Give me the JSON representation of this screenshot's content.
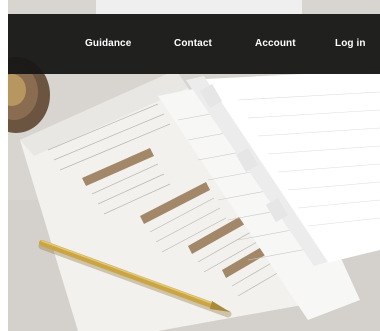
{
  "nav": {
    "items": [
      {
        "label": "Guidance"
      },
      {
        "label": "Contact"
      },
      {
        "label": "Account"
      },
      {
        "label": "Log in"
      }
    ]
  },
  "colors": {
    "navbar_bg": "#181818",
    "nav_text": "#ffffff",
    "desk_surface": "#d9d6d1",
    "pen_gold": "#c9a545"
  },
  "hero": {
    "icons": [
      "documents-image",
      "pen-icon",
      "bowl-icon"
    ]
  }
}
